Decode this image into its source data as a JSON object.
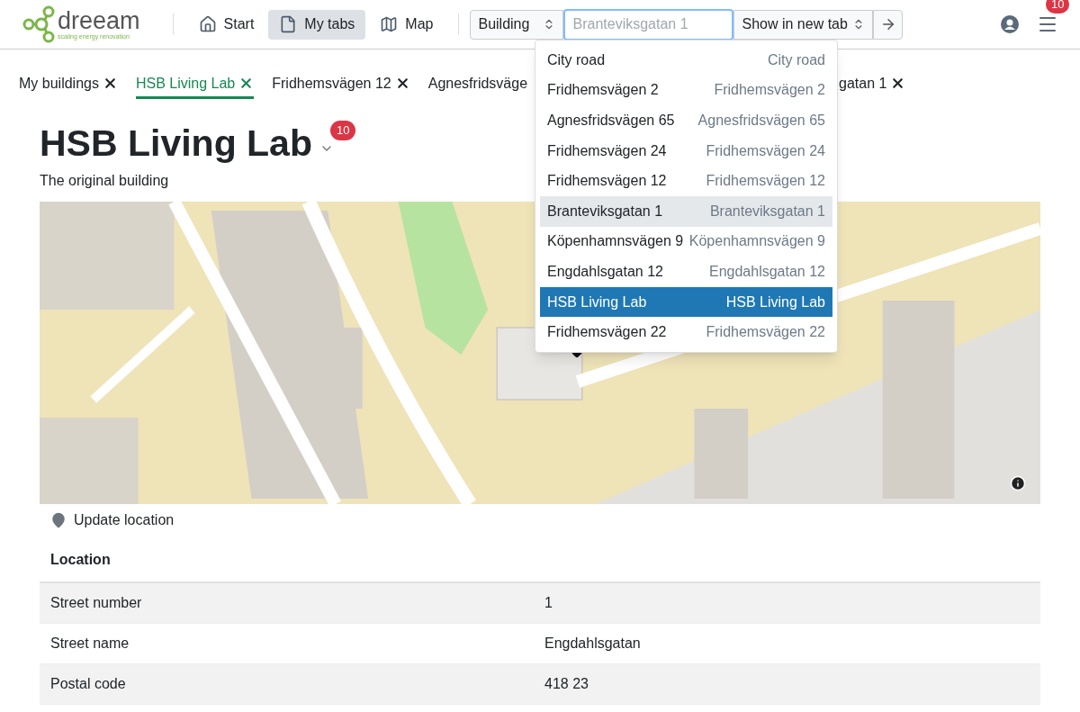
{
  "logo": {
    "name": "dreeam",
    "tagline": "scaling energy renovation"
  },
  "nav": [
    {
      "label": "Start",
      "selected": false
    },
    {
      "label": "My tabs",
      "selected": true
    },
    {
      "label": "Map",
      "selected": false
    }
  ],
  "search": {
    "type_select": "Building",
    "placeholder": "Branteviksgatan 1",
    "target_select": "Show in new tab"
  },
  "menu_badge": "10",
  "suggestions": [
    {
      "name": "City road",
      "address": "City road",
      "hovered": false,
      "selected": false
    },
    {
      "name": "Fridhemsvägen 2",
      "address": "Fridhemsvägen 2",
      "hovered": false,
      "selected": false
    },
    {
      "name": "Agnesfridsvägen 65",
      "address": "Agnesfridsvägen 65",
      "hovered": false,
      "selected": false
    },
    {
      "name": "Fridhemsvägen 24",
      "address": "Fridhemsvägen 24",
      "hovered": false,
      "selected": false
    },
    {
      "name": "Fridhemsvägen 12",
      "address": "Fridhemsvägen 12",
      "hovered": false,
      "selected": false
    },
    {
      "name": "Branteviksgatan 1",
      "address": "Branteviksgatan 1",
      "hovered": true,
      "selected": false
    },
    {
      "name": "Köpenhamnsvägen 9",
      "address": "Köpenhamnsvägen 9",
      "hovered": false,
      "selected": false
    },
    {
      "name": "Engdahlsgatan 12",
      "address": "Engdahlsgatan 12",
      "hovered": false,
      "selected": false
    },
    {
      "name": "HSB Living Lab",
      "address": "HSB Living Lab",
      "hovered": false,
      "selected": true
    },
    {
      "name": "Fridhemsvägen 22",
      "address": "Fridhemsvägen 22",
      "hovered": false,
      "selected": false
    }
  ],
  "tabs": [
    {
      "label": "My buildings",
      "selected": false,
      "close": true
    },
    {
      "label": "HSB Living Lab",
      "selected": true,
      "close": true
    },
    {
      "label": "Fridhemsvägen 12",
      "selected": false,
      "close": true
    },
    {
      "label": "Agnesfridsväge",
      "selected": false,
      "close": false
    },
    {
      "label": "gatan 1",
      "selected": false,
      "close": true
    }
  ],
  "building": {
    "title": "HSB Living Lab",
    "badge": "10",
    "description": "The original building"
  },
  "update_location": "Update location",
  "location": {
    "heading": "Location",
    "rows": [
      {
        "label": "Street number",
        "value": "1"
      },
      {
        "label": "Street name",
        "value": "Engdahlsgatan"
      },
      {
        "label": "Postal code",
        "value": "418 23"
      }
    ]
  }
}
